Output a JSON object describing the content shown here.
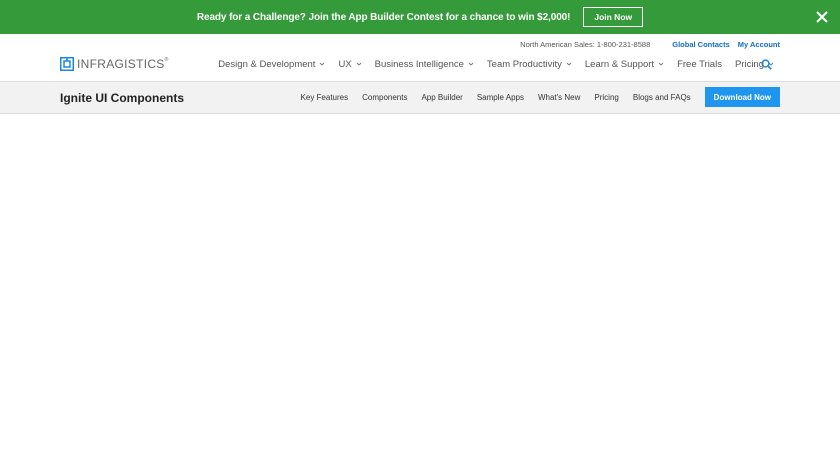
{
  "promo": {
    "text": "Ready for a Challenge? Join the App Builder Contest for a chance to win $2,000!",
    "button_label": "Join Now",
    "close_icon": "close-icon",
    "bg_color": "#349a3a"
  },
  "utility": {
    "sales": "North American Sales: 1-800-231-8588",
    "global_contacts": "Global Contacts",
    "my_account": "My Account"
  },
  "logo": {
    "text": "INFRAGISTICS",
    "reg": "®"
  },
  "main_nav": {
    "items": [
      {
        "label": "Design & Development",
        "has_dropdown": true
      },
      {
        "label": "UX",
        "has_dropdown": true
      },
      {
        "label": "Business Intelligence",
        "has_dropdown": true
      },
      {
        "label": "Team Productivity",
        "has_dropdown": true
      },
      {
        "label": "Learn & Support",
        "has_dropdown": true
      },
      {
        "label": "Free Trials",
        "has_dropdown": false
      },
      {
        "label": "Pricing",
        "has_dropdown": true
      }
    ],
    "search_icon": "search-icon"
  },
  "sub_header": {
    "title": "Ignite UI Components",
    "links": [
      "Key Features",
      "Components",
      "App Builder",
      "Sample Apps",
      "What's New",
      "Pricing",
      "Blogs and FAQs"
    ],
    "cta_label": "Download Now",
    "cta_color": "#1e96f0"
  }
}
